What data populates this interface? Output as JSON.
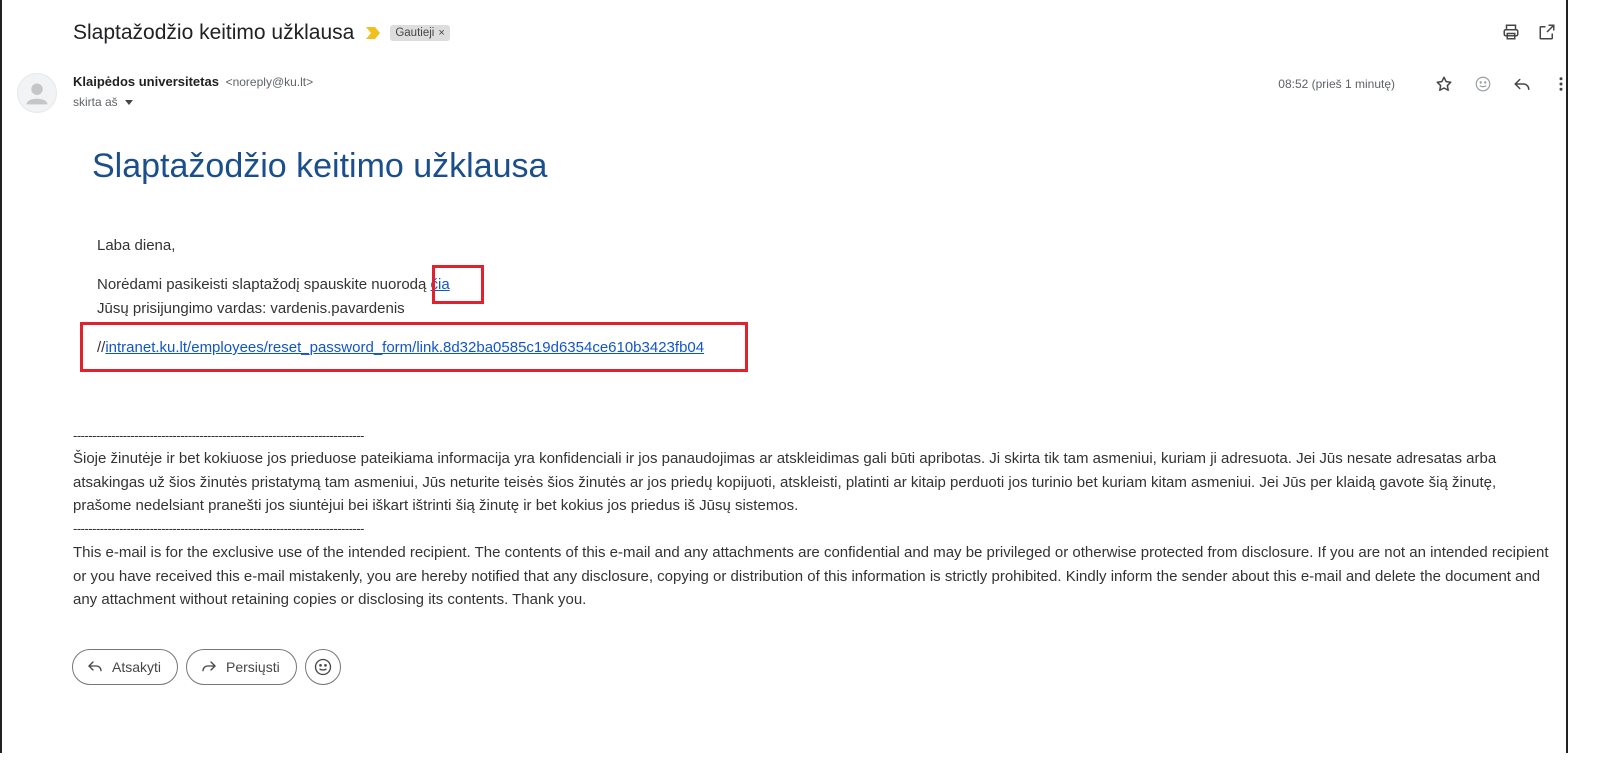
{
  "email": {
    "subject": "Slaptažodžio keitimo užklausa",
    "label": "Gautieji",
    "label_remove": "×",
    "sender_name": "Klaipėdos universitetas",
    "sender_email": "<noreply@ku.lt>",
    "to_text": "skirta aš",
    "timestamp": "08:52 (prieš 1 minutę)"
  },
  "icons": {
    "important": "important-marker-icon",
    "print": "print-icon",
    "open_new_window": "open-in-new-window-icon",
    "avatar": "default-avatar-icon",
    "star": "star-icon",
    "emoji": "emoji-reaction-icon",
    "reply": "reply-icon",
    "more": "more-vert-icon",
    "forward": "forward-icon"
  },
  "body": {
    "title": "Slaptažodžio keitimo užklausa",
    "greeting": "Laba diena,",
    "instruction_prefix": "Norėdami pasikeisti slaptažodį spauskite nuorodą ",
    "instruction_link": "čia",
    "username_line": "Jūsų prisijungimo vardas: vardenis.pavardenis",
    "url_prefix": "//",
    "url_link": "intranet.ku.lt/employees/reset_password_form/link.8d32ba0585c19d6354ce610b3423fb04",
    "divider": "----------------------------------------------------------------------------",
    "disclaimer_lt": "Šioje žinutėje ir bet kokiuose jos prieduose pateikiama informacija yra konfidenciali ir jos panaudojimas ar atskleidimas gali būti apribotas. Ji skirta tik tam asmeniui, kuriam ji adresuota. Jei Jūs nesate adresatas arba atsakingas už šios žinutės pristatymą tam asmeniui, Jūs neturite teisės šios žinutės ar jos priedų kopijuoti, atskleisti, platinti ar kitaip perduoti jos turinio bet kuriam kitam asmeniui. Jei Jūs per klaidą gavote šią žinutę, prašome nedelsiant pranešti jos siuntėjui bei iškart ištrinti šią žinutę ir bet kokius jos priedus iš Jūsų sistemos.",
    "disclaimer_en": "This e-mail is for the exclusive use of the intended recipient. The contents of this e-mail and any attachments are confidential and may be privileged or otherwise protected from disclosure. If you are not an intended recipient or you have received this e-mail mistakenly, you are hereby notified that any disclosure, copying or distribution of this information is strictly prohibited. Kindly inform the sender about this e-mail and delete the document and any attachment without retaining copies or disclosing its contents. Thank you."
  },
  "actions": {
    "reply_label": "Atsakyti",
    "forward_label": "Persiųsti"
  },
  "colors": {
    "title_blue": "#1a4f8b",
    "link_blue": "#1155cc",
    "highlight_red": "#e0212e",
    "important_yellow": "#f2c01e"
  }
}
